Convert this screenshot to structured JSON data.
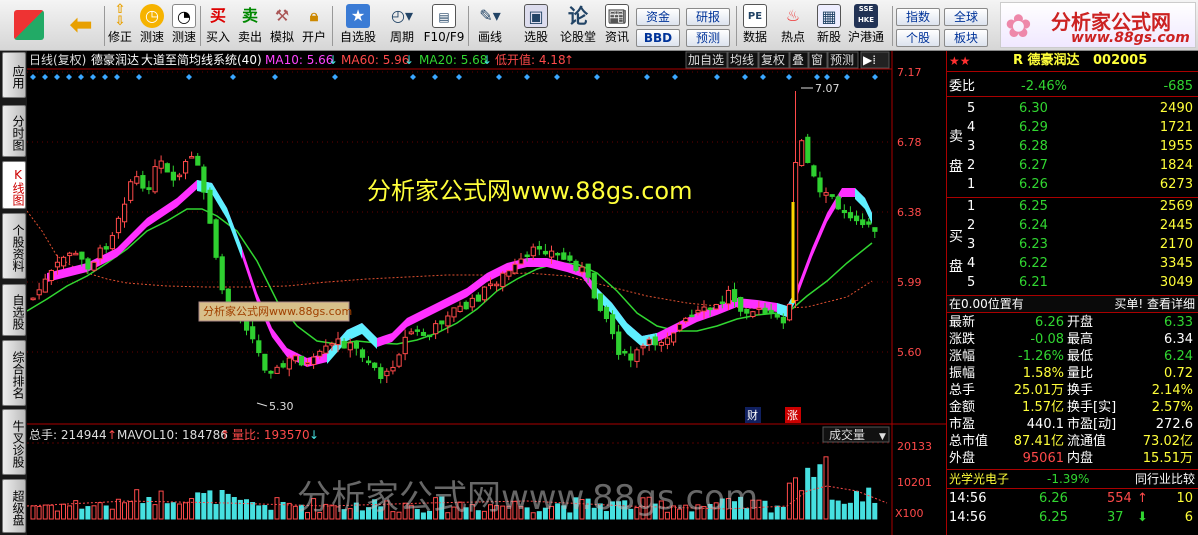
{
  "toolbar": {
    "buttons": [
      {
        "label": "修正",
        "icon": "up-down-arrows-icon"
      },
      {
        "label": "测速",
        "icon": "clock-icon"
      },
      {
        "label": "买入",
        "icon": "buy-icon",
        "glyph": "买"
      },
      {
        "label": "卖出",
        "icon": "sell-icon",
        "glyph": "卖"
      },
      {
        "label": "模拟",
        "icon": "hammer-icon"
      },
      {
        "label": "开户",
        "icon": "lock-icon"
      },
      {
        "label": "自选股",
        "icon": "star-icon"
      },
      {
        "label": "周期",
        "icon": "period-icon"
      },
      {
        "label": "F10/F9",
        "icon": "f10-icon"
      },
      {
        "label": "画线",
        "icon": "pencil-icon"
      },
      {
        "label": "选股",
        "icon": "select-stock-icon"
      },
      {
        "label": "论股堂",
        "icon": "forum-icon",
        "glyph": "论"
      },
      {
        "label": "资讯",
        "icon": "news-icon"
      },
      {
        "label": "数据",
        "icon": "data-icon",
        "glyph": "PE"
      },
      {
        "label": "热点",
        "icon": "fire-icon"
      },
      {
        "label": "新股",
        "icon": "new-stock-icon"
      },
      {
        "label": "沪港通",
        "icon": "hk-connect-icon",
        "glyph": "SSE HKE"
      }
    ],
    "small_buttons": [
      "资金",
      "研报",
      "BBD",
      "预测",
      "指数",
      "全球",
      "个股",
      "板块"
    ],
    "logo_title": "分析家公式网",
    "logo_url": "www.88gs.com"
  },
  "left_tabs": [
    "应用",
    "分时图",
    "K线图",
    "个股资料",
    "自选股",
    "综合排名",
    "牛叉诊股",
    "超级盘"
  ],
  "chart_header": {
    "period": "日线(复权)",
    "stock": "德豪润达",
    "formula": "大道至简均线系统(40)",
    "ma10_label": "MA10: 5.66",
    "ma60_label": "MA60: 5.96",
    "ma20_label": "MA20: 5.68",
    "low_label": "低开值: 4.18",
    "buttons": [
      "加自选",
      "均线",
      "复权",
      "叠",
      "窗",
      "预测"
    ]
  },
  "watermark_main": "分析家公式网www.88gs.com",
  "watermark_small": "分析家公式网www.88gs.com",
  "watermark_bottom": "分析家公式网www.88gs.com",
  "price_axis": [
    "7.17",
    "6.78",
    "6.38",
    "5.99",
    "5.60"
  ],
  "price_high_label": "7.07",
  "price_low_label": "5.30",
  "event_labels": {
    "finance": "财",
    "rise": "涨"
  },
  "volume_header": {
    "total": "总手: 214944",
    "mavol": "MAVOL10: 184786",
    "ratio": "量比: 193570",
    "dropdown": "成交量"
  },
  "volume_axis": [
    "20133",
    "10201",
    "X100"
  ],
  "chart_data": {
    "type": "candlestick",
    "ylim": [
      5.25,
      7.17
    ],
    "high_mark": 7.07,
    "low_mark": 5.3
  },
  "quote": {
    "title": "R 德豪润达",
    "code": "002005",
    "weibi_label": "委比",
    "weibi_pct": "-2.46%",
    "weibi_val": "-685",
    "sell_label": "卖盘",
    "buy_label": "买盘",
    "asks": [
      {
        "n": "5",
        "price": "6.30",
        "vol": "2490"
      },
      {
        "n": "4",
        "price": "6.29",
        "vol": "1721"
      },
      {
        "n": "3",
        "price": "6.28",
        "vol": "1955"
      },
      {
        "n": "2",
        "price": "6.27",
        "vol": "1824"
      },
      {
        "n": "1",
        "price": "6.26",
        "vol": "6273"
      }
    ],
    "bids": [
      {
        "n": "1",
        "price": "6.25",
        "vol": "2569"
      },
      {
        "n": "2",
        "price": "6.24",
        "vol": "2445"
      },
      {
        "n": "3",
        "price": "6.23",
        "vol": "2170"
      },
      {
        "n": "4",
        "price": "6.22",
        "vol": "3345"
      },
      {
        "n": "5",
        "price": "6.21",
        "vol": "3049"
      }
    ],
    "position_text": "在0.00位置有",
    "position_link": "买单! 查看详细",
    "stats": [
      [
        "最新",
        "6.26",
        "开盘",
        "6.33"
      ],
      [
        "涨跌",
        "-0.08",
        "最高",
        "6.34"
      ],
      [
        "涨幅",
        "-1.26%",
        "最低",
        "6.24"
      ],
      [
        "振幅",
        "1.58%",
        "量比",
        "0.72"
      ],
      [
        "总手",
        "25.01万",
        "换手",
        "2.14%"
      ],
      [
        "金额",
        "1.57亿",
        "换手[实]",
        "2.57%"
      ],
      [
        "市盈",
        "440.1",
        "市盈[动]",
        "272.6"
      ],
      [
        "总市值",
        "87.41亿",
        "流通值",
        "73.02亿"
      ],
      [
        "外盘",
        "95061",
        "内盘",
        "15.51万"
      ]
    ],
    "industry": "光学光电子",
    "industry_pct": "-1.39%",
    "industry_link": "同行业比较",
    "ticks": [
      {
        "time": "14:56",
        "price": "6.26",
        "vol": "554",
        "arrow": "up",
        "n": "10"
      },
      {
        "time": "14:56",
        "price": "6.25",
        "vol": "37",
        "arrow": "down",
        "n": "6"
      }
    ]
  }
}
